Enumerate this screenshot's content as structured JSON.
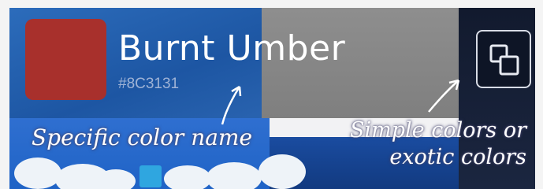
{
  "swatch": {
    "color": "#A8302C"
  },
  "color_info": {
    "name": "Burnt Umber",
    "hex": "#8C3131"
  },
  "copy_button": {
    "icon": "copy-icon"
  },
  "annotations": {
    "left": "Specific color name",
    "right_line1": "Simple colors or",
    "right_line2": "exotic colors"
  },
  "colors": {
    "text_white": "#FFFFFF",
    "hex_text": "#9FB3D6"
  }
}
